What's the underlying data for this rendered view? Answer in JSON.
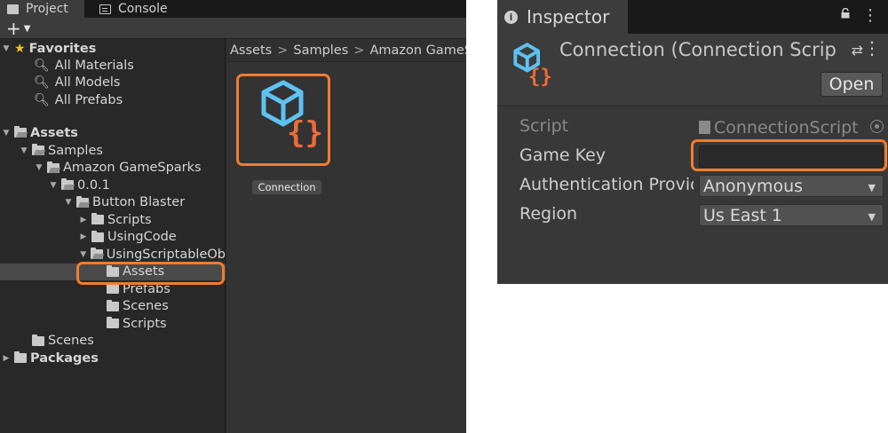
{
  "project_panel": {
    "tabs": [
      {
        "label": "Project",
        "icon": "folder-icon",
        "active": true
      },
      {
        "label": "Console",
        "icon": "console-icon",
        "active": false
      }
    ],
    "toolbar": {
      "add_label": "+",
      "add_icon": "dropdown-caret-icon"
    },
    "tree": {
      "favorites": {
        "label": "Favorites",
        "items": [
          "All Materials",
          "All Models",
          "All Prefabs"
        ]
      },
      "assets": {
        "label": "Assets",
        "samples": "Samples",
        "amazon_gamesparks": "Amazon GameSparks",
        "version": "0.0.1",
        "button_blaster": "Button Blaster",
        "scripts": "Scripts",
        "using_code": "UsingCode",
        "using_scriptable": "UsingScriptableOb",
        "selected_assets": "Assets",
        "prefabs": "Prefabs",
        "scenes_inner": "Scenes",
        "scripts_inner": "Scripts",
        "scenes": "Scenes"
      },
      "packages": "Packages"
    },
    "breadcrumb": [
      "Assets",
      "Samples",
      "Amazon GameSparks"
    ],
    "asset": {
      "label": "Connection",
      "icon": "scriptable-object-icon"
    }
  },
  "inspector_panel": {
    "tab_label": "Inspector",
    "title": "Connection (Connection Script",
    "open_button": "Open",
    "fields": {
      "script_label": "Script",
      "script_value": "ConnectionScript",
      "game_key_label": "Game Key",
      "game_key_value": "",
      "auth_label": "Authentication Provic",
      "auth_value": "Anonymous",
      "region_label": "Region",
      "region_value": "Us East 1"
    }
  },
  "colors": {
    "highlight": "#f07d2f",
    "icon_blue": "#5ec1f2",
    "icon_orange": "#ef6a3a",
    "panel_bg": "#282828",
    "inspector_bg": "#383838"
  }
}
